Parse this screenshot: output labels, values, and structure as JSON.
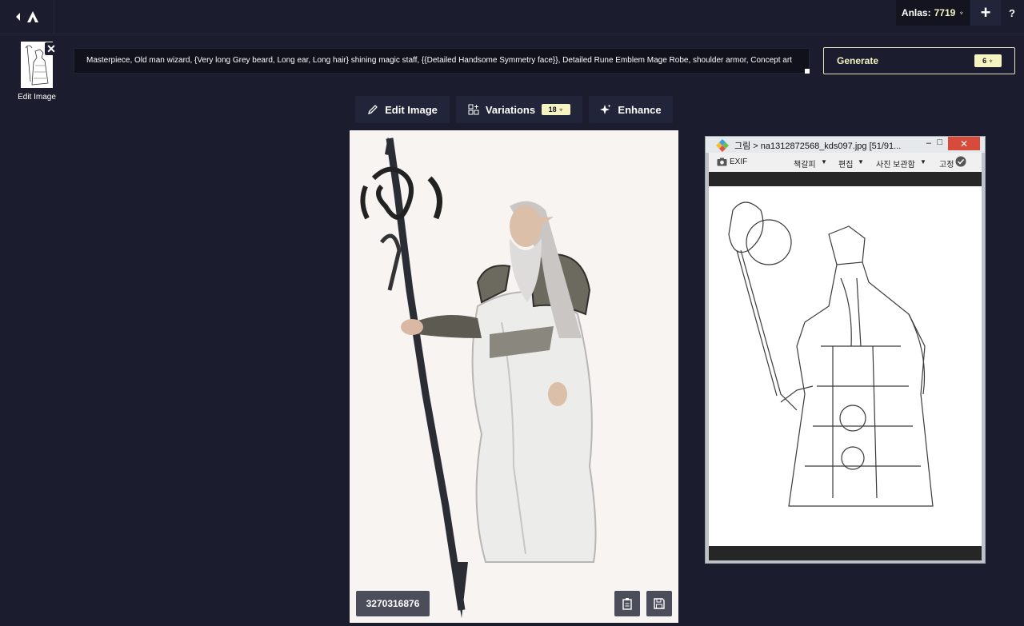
{
  "topbar": {
    "anlas_label": "Anlas:",
    "anlas_value": "7719",
    "plus_label": "+",
    "help_label": "?"
  },
  "sidebar": {
    "thumb_label": "Edit Image",
    "close_label": "✕"
  },
  "prompt": {
    "text": "Masterpiece, Old man wizard, {Very long Grey beard, Long ear, Long hair} shining magic staff, {{Detailed Handsome Symmetry face}}, Detailed Rune Emblem Mage Robe, shoulder armor, Concept art"
  },
  "generate": {
    "label": "Generate",
    "cost": "6"
  },
  "actions": {
    "edit_label": "Edit Image",
    "variations_label": "Variations",
    "variations_cost": "18",
    "enhance_label": "Enhance"
  },
  "result": {
    "seed": "3270316876"
  },
  "viewer": {
    "title": "그림 > na1312872568_kds097.jpg [51/91...",
    "close_label": "✕",
    "toolbar": {
      "exif": "EXIF",
      "bookmark": "책갈피",
      "edit": "편집",
      "save": "사진 보관함",
      "pin": "고정"
    }
  },
  "colors": {
    "background": "#1b1c2d",
    "accent": "#f5f3c2",
    "button": "#22253a"
  }
}
